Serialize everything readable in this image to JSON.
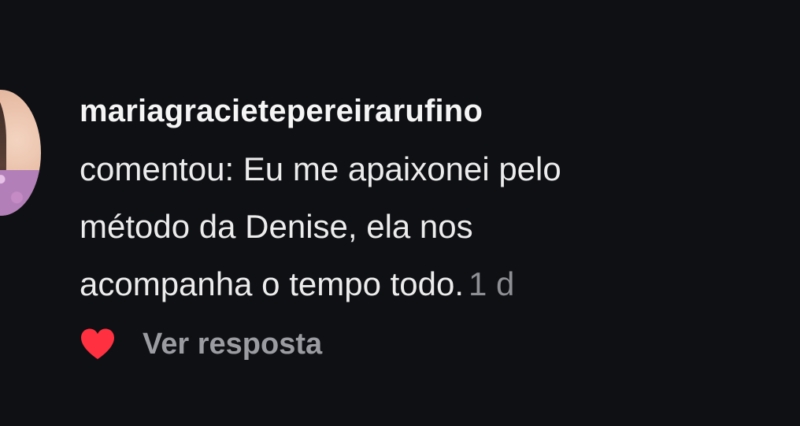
{
  "comment": {
    "username": "mariagracietepereirarufino",
    "lines": [
      "comentou: Eu me apaixonei pelo",
      "método da Denise, ela nos",
      "acompanha o tempo todo."
    ],
    "timestamp": "1 d"
  },
  "actions": {
    "like_icon": "heart-icon",
    "like_color": "#ff3040",
    "reply_label": "Ver resposta"
  },
  "colors": {
    "background": "#0f1014",
    "text": "#ececec",
    "muted": "#8e8f95"
  }
}
